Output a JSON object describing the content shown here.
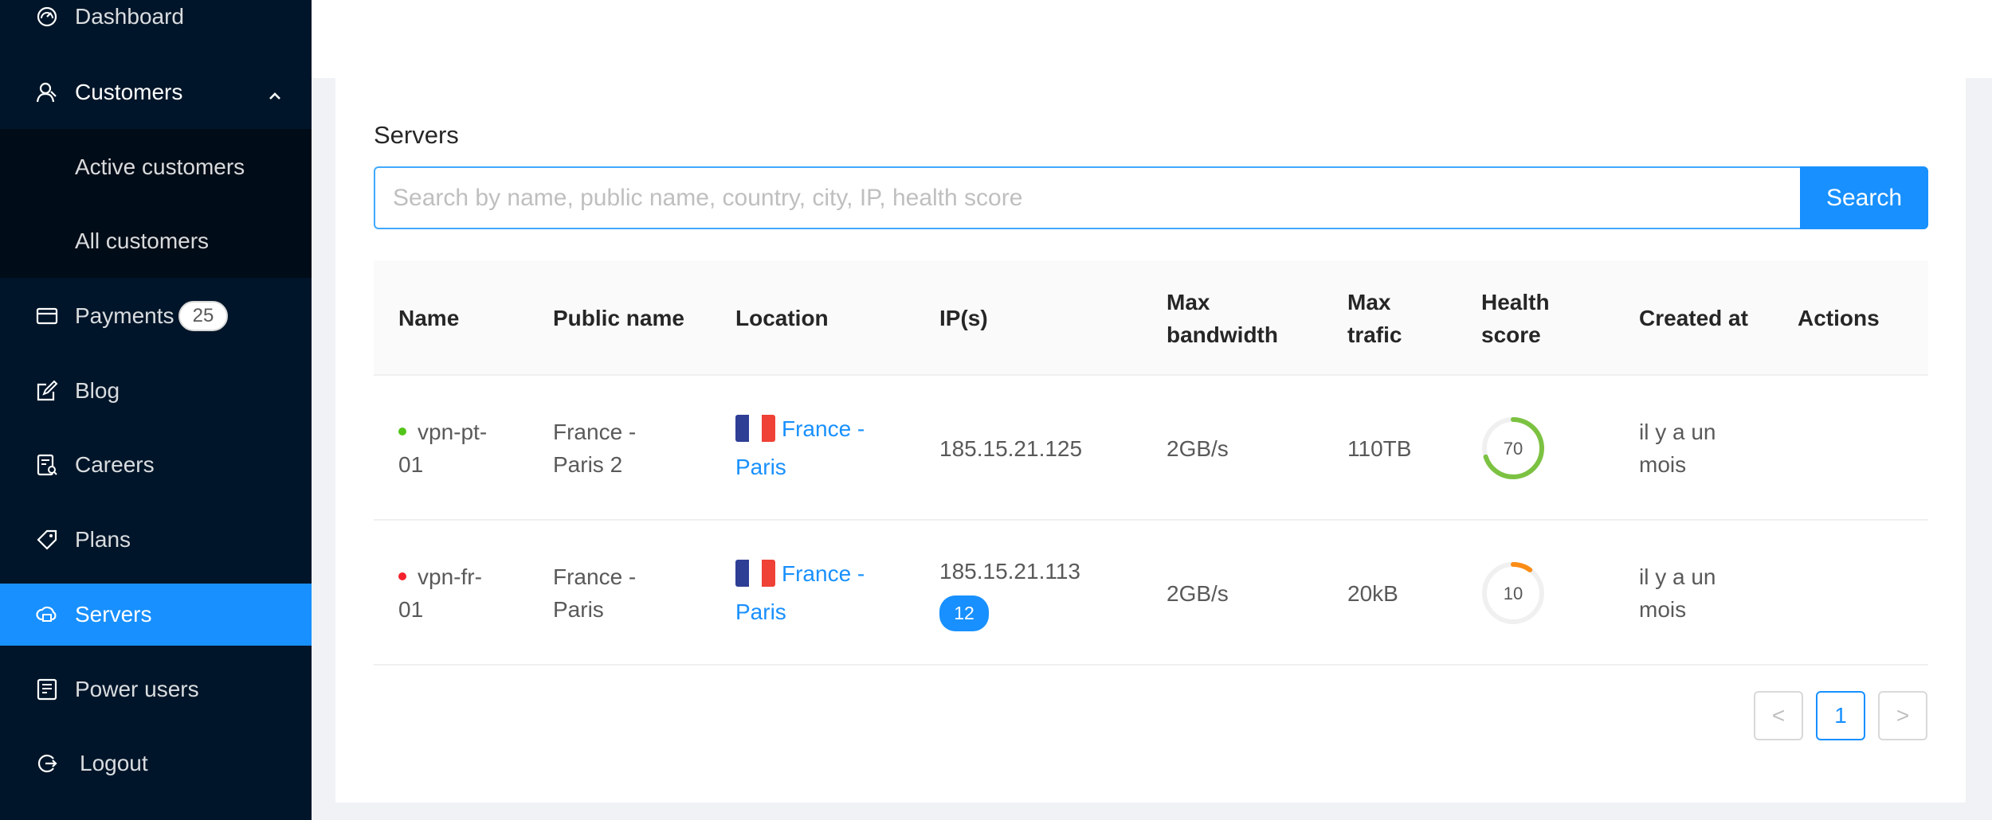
{
  "sidebar": {
    "items": [
      {
        "label": "Dashboard",
        "icon": "dashboard-icon"
      },
      {
        "label": "Customers",
        "icon": "customers-icon"
      },
      {
        "label": "Active customers"
      },
      {
        "label": "All customers"
      },
      {
        "label": "Payments",
        "icon": "payments-icon",
        "badge": "25"
      },
      {
        "label": "Blog",
        "icon": "blog-icon"
      },
      {
        "label": "Careers",
        "icon": "careers-icon"
      },
      {
        "label": "Plans",
        "icon": "plans-icon"
      },
      {
        "label": "Servers",
        "icon": "servers-icon"
      },
      {
        "label": "Power users",
        "icon": "power-users-icon"
      },
      {
        "label": "Logout",
        "icon": "logout-icon"
      }
    ],
    "active": "Servers",
    "colors": {
      "background": "#001529",
      "active": "#1890ff"
    }
  },
  "main": {
    "title": "Servers",
    "search": {
      "placeholder": "Search by name, public name, country, city, IP, health score",
      "value": "",
      "button": "Search"
    },
    "table": {
      "headers": {
        "name": "Name",
        "public_name": "Public name",
        "location": "Location",
        "ips": "IP(s)",
        "max_bandwidth_1": "Max",
        "max_bandwidth_2": "bandwidth",
        "max_trafic_1": "Max",
        "max_trafic_2": "trafic",
        "health_1": "Health",
        "health_2": "score",
        "created_at": "Created at",
        "actions": "Actions"
      },
      "rows": [
        {
          "status_color": "#52c41a",
          "name_1": "vpn-pt-",
          "name_2": "01",
          "public_name_1": "France -",
          "public_name_2": "Paris 2",
          "location_1": "France -",
          "location_2": "Paris",
          "ip": "185.15.21.125",
          "ip_badge": "",
          "max_bandwidth": "2GB/s",
          "max_trafic": "110TB",
          "health_score": "70",
          "health_value": 70,
          "health_color": "#7cc242",
          "created_1": "il y a un",
          "created_2": "mois"
        },
        {
          "status_color": "#f5222d",
          "name_1": "vpn-fr-",
          "name_2": "01",
          "public_name_1": "France -",
          "public_name_2": "Paris",
          "location_1": "France -",
          "location_2": "Paris",
          "ip": "185.15.21.113",
          "ip_badge": "12",
          "max_bandwidth": "2GB/s",
          "max_trafic": "20kB",
          "health_score": "10",
          "health_value": 10,
          "health_color": "#fa8c16",
          "created_1": "il y a un",
          "created_2": "mois"
        }
      ]
    },
    "pagination": {
      "prev": "<",
      "current": "1",
      "next": ">"
    }
  }
}
